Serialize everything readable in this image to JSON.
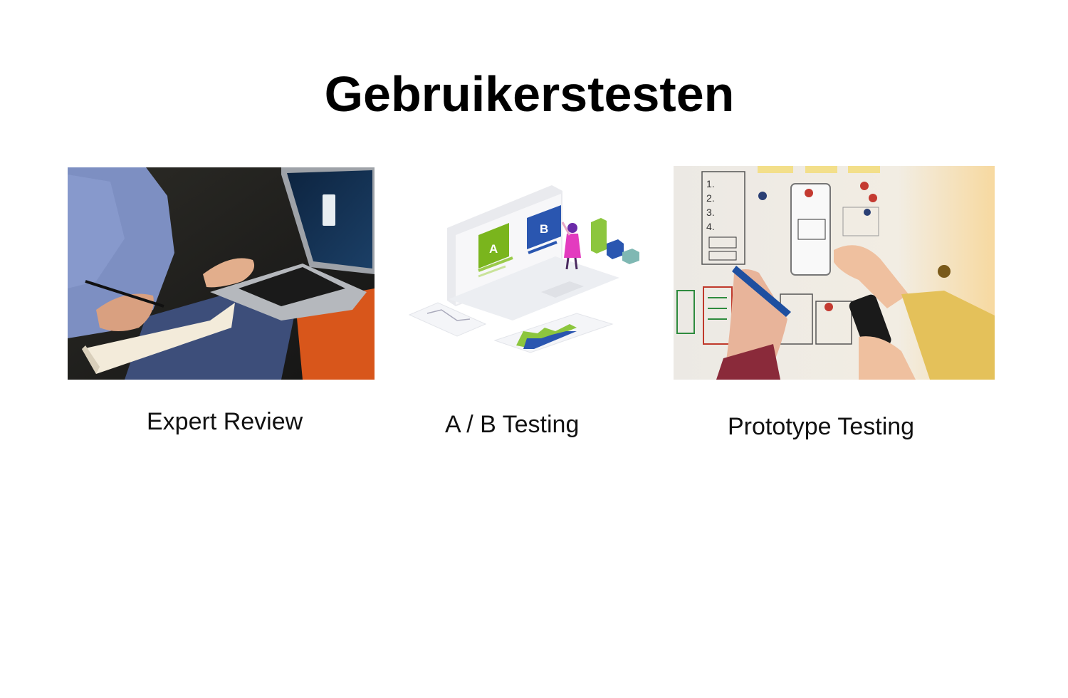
{
  "slide": {
    "title": "Gebruikerstesten"
  },
  "panels": [
    {
      "caption": "Expert Review",
      "image": "person-with-laptop-and-notebook-photo"
    },
    {
      "caption": "A / B Testing",
      "image": "ab-testing-isometric-illustration",
      "labels": {
        "a": "A",
        "b": "B"
      }
    },
    {
      "caption": "Prototype Testing",
      "image": "whiteboard-wireframe-sketching-photo",
      "list_numbers": [
        "1.",
        "2.",
        "3.",
        "4."
      ]
    }
  ]
}
